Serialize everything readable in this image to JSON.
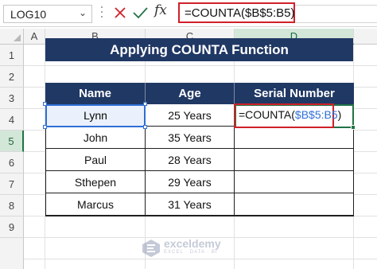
{
  "formula_bar": {
    "name_box": "LOG10",
    "cancel_icon": "x-icon",
    "enter_icon": "check-icon",
    "fx_label": "fx",
    "formula": "=COUNTA($B$5:B5)"
  },
  "columns": [
    "A",
    "B",
    "C",
    "D"
  ],
  "rows": [
    "1",
    "2",
    "3",
    "4",
    "5",
    "6",
    "7",
    "8",
    "9"
  ],
  "title": "Applying COUNTA Function",
  "table": {
    "headers": [
      "Name",
      "Age",
      "Serial Number"
    ],
    "rows": [
      {
        "name": "Lynn",
        "age": "25 Years"
      },
      {
        "name": "John",
        "age": "35 Years"
      },
      {
        "name": "Paul",
        "age": "28 Years"
      },
      {
        "name": "Sthepen",
        "age": "29 Years"
      },
      {
        "name": "Marcus",
        "age": "31 Years"
      }
    ]
  },
  "edit_cell": {
    "prefix": "=COUNTA(",
    "ref": "$B$5:B5",
    "suffix": ")"
  },
  "watermark": {
    "name": "exceldemy",
    "tagline": "EXCEL · DATA · BI"
  },
  "colors": {
    "header_bg": "#203864",
    "accent_red": "#d0202a",
    "excel_green": "#217346",
    "ref_blue": "#2f6fd6"
  }
}
